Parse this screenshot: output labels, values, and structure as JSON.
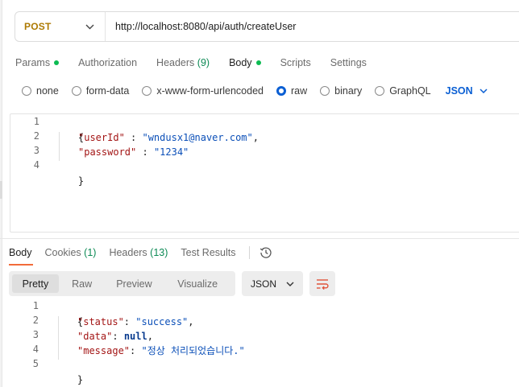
{
  "request": {
    "method": "POST",
    "url": "http://localhost:8080/api/auth/createUser",
    "tabs": [
      {
        "label": "Params",
        "dot": true
      },
      {
        "label": "Authorization"
      },
      {
        "label": "Headers",
        "count": "(9)"
      },
      {
        "label": "Body",
        "dot": true,
        "active": true
      },
      {
        "label": "Scripts"
      },
      {
        "label": "Settings"
      }
    ],
    "body_types": [
      "none",
      "form-data",
      "x-www-form-urlencoded",
      "raw",
      "binary",
      "GraphQL"
    ],
    "selected_body_type": "raw",
    "language": "JSON",
    "body_lines": [
      "1",
      "2",
      "3",
      "4"
    ],
    "body": {
      "open": "{",
      "close": "}",
      "userId_key": "\"userId\"",
      "userId_value": "\"wndusx1@naver.com\"",
      "password_key": "\"password\"",
      "password_value": "\"1234\""
    }
  },
  "response": {
    "tabs": [
      {
        "label": "Body",
        "active": true
      },
      {
        "label": "Cookies",
        "count": "(1)"
      },
      {
        "label": "Headers",
        "count": "(13)"
      },
      {
        "label": "Test Results"
      }
    ],
    "views": [
      "Pretty",
      "Raw",
      "Preview",
      "Visualize"
    ],
    "active_view": "Pretty",
    "format": "JSON",
    "body_lines": [
      "1",
      "2",
      "3",
      "4",
      "5"
    ],
    "body": {
      "open": "{",
      "close": "}",
      "status_key": "\"status\"",
      "status_value": "\"success\"",
      "data_key": "\"data\"",
      "data_value": "null",
      "message_key": "\"message\"",
      "message_value": "\"정상 처리되었습니다.\""
    }
  },
  "colors": {
    "method": "#ad7a03",
    "accent_blue": "#0b5fd3",
    "active_tab_underline": "#f26b3a",
    "status_green": "#0cbb52",
    "json_key": "#a31515",
    "json_string": "#0b4fb8"
  },
  "icons": {
    "method_dropdown": "chevron-down-icon",
    "language_dropdown": "chevron-down-icon",
    "history": "history-icon",
    "format_dropdown": "chevron-down-icon",
    "wrap": "wrap-lines-icon"
  }
}
